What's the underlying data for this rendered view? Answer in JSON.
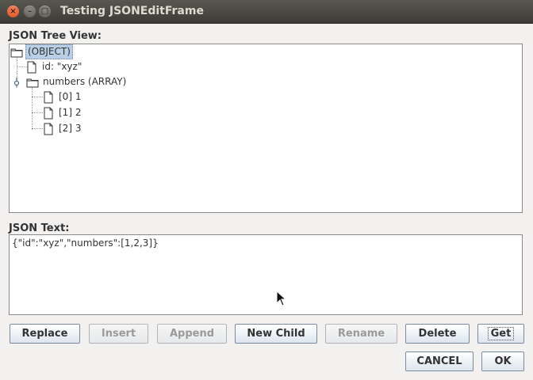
{
  "window": {
    "title": "Testing JSONEditFrame"
  },
  "tree_section": {
    "label": "JSON Tree View:"
  },
  "tree": {
    "root": "(OBJECT)",
    "nodes": [
      "id: \"xyz\"",
      "numbers (ARRAY)",
      "[0] 1",
      "[1] 2",
      "[2] 3"
    ]
  },
  "text_section": {
    "label": "JSON Text:",
    "value": "{\"id\":\"xyz\",\"numbers\":[1,2,3]}"
  },
  "buttons": {
    "replace": "Replace",
    "insert": "Insert",
    "append": "Append",
    "new_child": "New Child",
    "rename": "Rename",
    "delete": "Delete",
    "get": "Get",
    "cancel": "CANCEL",
    "ok": "OK"
  }
}
